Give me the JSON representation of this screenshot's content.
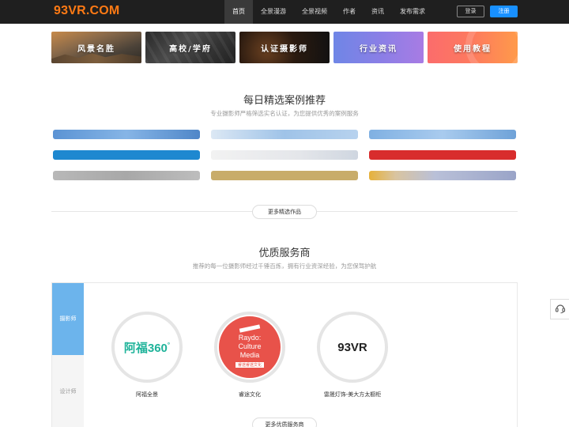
{
  "header": {
    "logo": "93VR.COM",
    "nav": [
      "首页",
      "全景漫游",
      "全景视频",
      "作者",
      "资讯",
      "发布需求"
    ],
    "login": "登录",
    "register": "注册"
  },
  "categories": [
    "风景名胜",
    "高校/学府",
    "认证摄影师",
    "行业资讯",
    "使用教程"
  ],
  "cases_section": {
    "title": "每日精选案例推荐",
    "subtitle": "专业摄影师严格筛选实名认证，为您提供优秀的案例服务",
    "more": "更多精选作品"
  },
  "providers_section": {
    "title": "优质服务商",
    "subtitle": "推荐的每一位摄影师经过千锤百炼，拥有行业资深经验，为您保驾护航",
    "tabs": [
      "摄影师",
      "设计师"
    ],
    "items": [
      {
        "name": "阿福全景",
        "logo_text": "阿福360",
        "logo_sup": "°"
      },
      {
        "name": "睿途文化",
        "logo_lines": [
          "Raydo:",
          "Culture",
          "Media"
        ],
        "logo_tag": "睿途睿途文化"
      },
      {
        "name": "雷晟灯饰-美大方太橱柜",
        "logo_text": "93VR"
      }
    ],
    "more": "更多优质服务商"
  },
  "colors": {
    "accent_logo": "#ff7a14",
    "register_blue": "#1890ff",
    "tab_active": "#6cb4ec"
  },
  "icons": {
    "support": "headset-icon"
  }
}
